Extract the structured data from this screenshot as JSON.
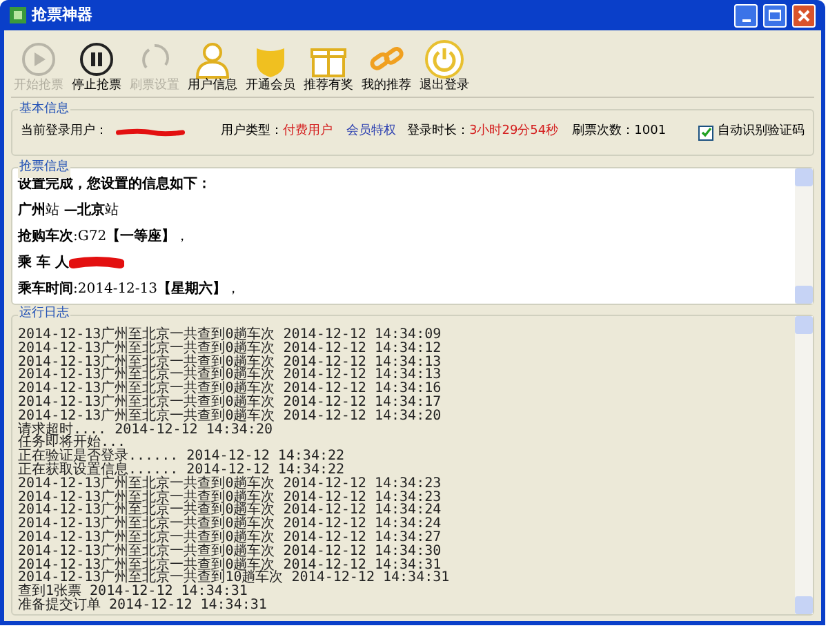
{
  "window": {
    "title": "抢票神器"
  },
  "toolbar": [
    {
      "label": "开始抢票",
      "kind": "play",
      "disabled": true
    },
    {
      "label": "停止抢票",
      "kind": "pause",
      "disabled": false
    },
    {
      "label": "刷票设置",
      "kind": "refresh",
      "disabled": true
    },
    {
      "label": "用户信息",
      "kind": "user",
      "disabled": false
    },
    {
      "label": "开通会员",
      "kind": "shield",
      "disabled": false
    },
    {
      "label": "推荐有奖",
      "kind": "gift",
      "disabled": false
    },
    {
      "label": "我的推荐",
      "kind": "link",
      "disabled": false
    },
    {
      "label": "退出登录",
      "kind": "power",
      "disabled": false
    }
  ],
  "basic_info": {
    "title": "基本信息",
    "user_label": "当前登录用户：",
    "type_label": "用户类型：",
    "type_value": "付费用户",
    "member_link": "会员特权",
    "duration_label": "登录时长：",
    "duration_value": "3小时29分54秒",
    "count_label": "刷票次数：",
    "count_value": "1001",
    "auto_captcha": {
      "label": "自动识别验证码",
      "checked": true
    }
  },
  "ticket_info": {
    "title": "抢票信息",
    "lines": [
      {
        "text": "**设置完成，您设置的信息如下：**",
        "redacted": false
      },
      {
        "text": "**广州**站 **—北京**站",
        "redacted": false
      },
      {
        "text": "**抢购车次**:G72**【一等座】**，",
        "redacted": false
      },
      {
        "text": "**乘 车 人**",
        "redacted": true
      },
      {
        "text": "**乘车时间**:2014-12-13**【星期六】**，",
        "redacted": false
      }
    ]
  },
  "log": {
    "title": "运行日志",
    "lines": [
      "2014-12-13广州至北京一共查到0趟车次 2014-12-12 14:34:09",
      "2014-12-13广州至北京一共查到0趟车次 2014-12-12 14:34:12",
      "2014-12-13广州至北京一共查到0趟车次 2014-12-12 14:34:13",
      "2014-12-13广州至北京一共查到0趟车次 2014-12-12 14:34:13",
      "2014-12-13广州至北京一共查到0趟车次 2014-12-12 14:34:16",
      "2014-12-13广州至北京一共查到0趟车次 2014-12-12 14:34:17",
      "2014-12-13广州至北京一共查到0趟车次 2014-12-12 14:34:20",
      "请求超时.... 2014-12-12 14:34:20",
      "任务即将开始...",
      "正在验证是否登录...... 2014-12-12 14:34:22",
      "正在获取设置信息...... 2014-12-12 14:34:22",
      "2014-12-13广州至北京一共查到0趟车次 2014-12-12 14:34:23",
      "2014-12-13广州至北京一共查到0趟车次 2014-12-12 14:34:23",
      "2014-12-13广州至北京一共查到0趟车次 2014-12-12 14:34:24",
      "2014-12-13广州至北京一共查到0趟车次 2014-12-12 14:34:24",
      "2014-12-13广州至北京一共查到0趟车次 2014-12-12 14:34:27",
      "2014-12-13广州至北京一共查到0趟车次 2014-12-12 14:34:30",
      "2014-12-13广州至北京一共查到0趟车次 2014-12-12 14:34:31",
      "2014-12-13广州至北京一共查到10趟车次 2014-12-12 14:34:31",
      "查到1张票 2014-12-12 14:34:31",
      "准备提交订单 2014-12-12 14:34:31"
    ]
  }
}
